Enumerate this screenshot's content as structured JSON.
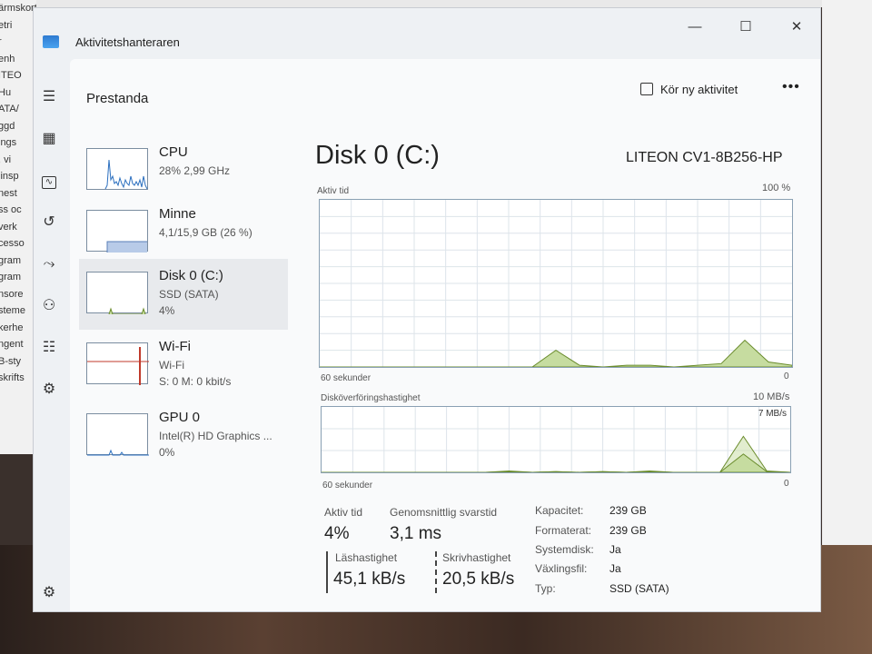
{
  "window": {
    "title": "Aktivitetshanteraren",
    "controls": {
      "minimize": "—",
      "maximize": "☐",
      "close": "✕"
    }
  },
  "background_left_text": [
    "ärmskort",
    "etri",
    "r",
    "enh",
    "ITEO",
    "Hu",
    "ATA/",
    "ggd",
    "ings",
    ", vi",
    "linsp",
    "nest",
    "ss oc",
    "verk",
    "cesso",
    "gram",
    "gram",
    "nsore",
    "steme",
    "kerhe",
    "ngent",
    "B-sty",
    "skrifts"
  ],
  "header": {
    "title": "Prestanda",
    "run_task": "Kör ny aktivitet",
    "more": "•••"
  },
  "devices": [
    {
      "name": "CPU",
      "sub1": "28% 2,99 GHz",
      "sub2": ""
    },
    {
      "name": "Minne",
      "sub1": "4,1/15,9 GB (26 %)",
      "sub2": ""
    },
    {
      "name": "Disk 0 (C:)",
      "sub1": "SSD (SATA)",
      "sub2": "4%"
    },
    {
      "name": "Wi-Fi",
      "sub1": "Wi-Fi",
      "sub2": "S: 0 M: 0 kbit/s"
    },
    {
      "name": "GPU 0",
      "sub1": "Intel(R) HD Graphics ...",
      "sub2": "0%"
    }
  ],
  "detail": {
    "title": "Disk 0 (C:)",
    "model": "LITEON CV1-8B256-HP",
    "chart1": {
      "label": "Aktiv tid",
      "max": "100 %",
      "xlabel": "60 sekunder",
      "min": "0"
    },
    "chart2": {
      "label": "Diskö­verföringshastighet",
      "max": "10 MB/s",
      "inner_max": "7 MB/s",
      "xlabel": "60 sekunder",
      "min": "0"
    }
  },
  "stats": {
    "active_time_label": "Aktiv tid",
    "active_time_value": "4%",
    "avg_response_label": "Genomsnittlig svarstid",
    "avg_response_value": "3,1 ms",
    "read_label": "Läshastighet",
    "read_value": "45,1 kB/s",
    "write_label": "Skrivhastighet",
    "write_value": "20,5 kB/s"
  },
  "properties": [
    {
      "label": "Kapacitet:",
      "value": "239 GB"
    },
    {
      "label": "Formaterat:",
      "value": "239 GB"
    },
    {
      "label": "Systemdisk:",
      "value": "Ja"
    },
    {
      "label": "Växlingsfil:",
      "value": "Ja"
    },
    {
      "label": "Typ:",
      "value": "SSD (SATA)"
    }
  ],
  "chart_data": [
    {
      "type": "area",
      "title": "Aktiv tid",
      "ylim": [
        0,
        100
      ],
      "x": [
        60,
        57,
        54,
        51,
        48,
        45,
        42,
        39,
        36,
        33,
        30,
        27,
        24,
        21,
        18,
        15,
        12,
        9,
        6,
        3,
        0
      ],
      "values": [
        0,
        0,
        0,
        0,
        0,
        0,
        0,
        0,
        0,
        0,
        10,
        1,
        0,
        1,
        1,
        0,
        1,
        2,
        16,
        3,
        1
      ]
    },
    {
      "type": "area",
      "title": "Diskö­verföringshastighet",
      "ylim": [
        0,
        10
      ],
      "series": [
        {
          "name": "read",
          "values": [
            0,
            0,
            0,
            0,
            0,
            0,
            0,
            0,
            0.2,
            0,
            0.1,
            0,
            0.1,
            0,
            0.2,
            0,
            0,
            0,
            5.5,
            0.2,
            0
          ]
        },
        {
          "name": "write",
          "values": [
            0,
            0,
            0,
            0,
            0,
            0,
            0,
            0,
            0.1,
            0,
            0.1,
            0,
            0.1,
            0,
            0.1,
            0,
            0,
            0,
            2.8,
            0.1,
            0
          ]
        }
      ],
      "x": [
        60,
        57,
        54,
        51,
        48,
        45,
        42,
        39,
        36,
        33,
        30,
        27,
        24,
        21,
        18,
        15,
        12,
        9,
        6,
        3,
        0
      ]
    }
  ],
  "colors": {
    "disk_fill": "#c6dca0",
    "disk_line": "#6a8c2c",
    "cpu_line": "#2b6fbf",
    "wifi_line": "#c0392b",
    "grid": "#dde4ea",
    "accent": "#0a5fb4"
  }
}
